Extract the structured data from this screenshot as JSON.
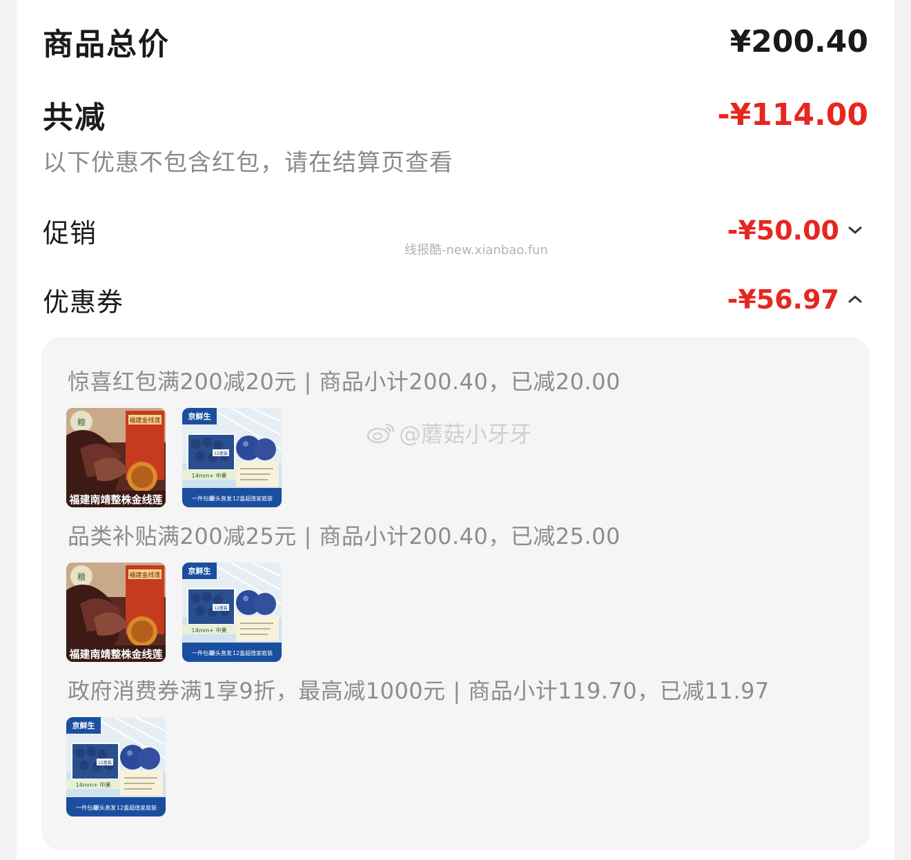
{
  "summary": {
    "total_label": "商品总价",
    "total_value": "¥200.40",
    "reduce_label": "共减",
    "reduce_value": "-¥114.00",
    "note": "以下优惠不包含红包，请在结算页查看"
  },
  "items": {
    "promo_label": "促销",
    "promo_value": "-¥50.00",
    "promo_icon": "chevron-down-icon",
    "coupon_label": "优惠券",
    "coupon_value": "-¥56.97",
    "coupon_icon": "chevron-up-icon"
  },
  "coupons": [
    {
      "rule": "惊喜红包满200减20元 | 商品小计200.40，已减20.00",
      "products": [
        "lotus",
        "blueberry"
      ]
    },
    {
      "rule": "品类补贴满200减25元 | 商品小计200.40，已减25.00",
      "products": [
        "lotus",
        "blueberry"
      ]
    },
    {
      "rule": "政府消费券满1享9折，最高减1000元 | 商品小计119.70，已减11.97",
      "products": [
        "blueberry"
      ]
    }
  ],
  "product_art": {
    "lotus_caption": "福建南靖整株金线莲",
    "lotus_logo": "粮",
    "lotus_box_label": "福建金线莲",
    "blueberry_brand": "京鲜生",
    "blueberry_size": "14mm+ 中果",
    "blueberry_ship": "一件包邮",
    "blueberry_direct": "源头直发",
    "blueberry_slogan": "12盒超值家庭装",
    "blueberry_box_tag": "12盒装"
  },
  "watermarks": {
    "site": "线报酷-new.xianbao.fun",
    "user": "@蘑菇小牙牙",
    "user_icon": "weibo-icon"
  },
  "colors": {
    "accent_red": "#e6261f",
    "muted_text": "#8c8c8c",
    "panel_bg": "#f5f5f5"
  }
}
